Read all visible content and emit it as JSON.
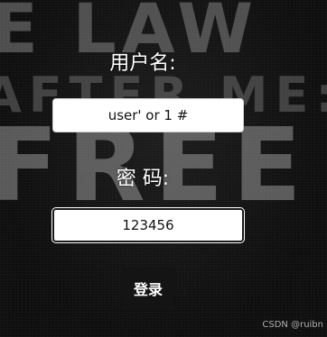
{
  "form": {
    "username_label": "用户名:",
    "username_value": "user' or 1 #",
    "password_label": "密 码:",
    "password_value": "123456",
    "login_label": "登录"
  },
  "background": {
    "line1": "E LAW",
    "line2": "AFTER ME:",
    "line3": "FREE"
  },
  "watermark": "CSDN @ruibn",
  "colors": {
    "background": "#0c0c0c",
    "label_text": "#ffffff",
    "button_bg": "#141414",
    "field_bg": "#ffffff"
  }
}
